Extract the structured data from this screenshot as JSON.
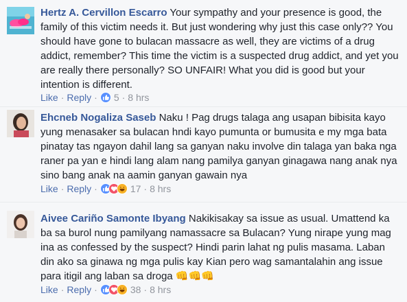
{
  "comments": [
    {
      "author": "Hertz A. Cervillon Escarro",
      "text": "Your sympathy and your presence is good, the family of this victim needs it. But just wondering why just this case only?? You should have gone to bulacan massacre as well, they are victims of a drug addict, remember? This time the victim is a suspected drug addict, and yet you are really there personally? SO UNFAIR! What you did is good but your intention is different.",
      "like": "Like",
      "reply": "Reply",
      "reaction_count": "5",
      "reaction_icons": [
        "like-icon"
      ],
      "time": "8 hrs"
    },
    {
      "author": "Ehcneb Nogaliza Saseb",
      "text": "Naku ! Pag drugs talaga ang usapan bibisita kayo yung menasaker sa bulacan hndi kayo pumunta or bumusita e my mga bata pinatay tas ngayon dahil lang sa ganyan naku involve din talaga yan baka nga raner pa yan e hindi lang alam nang pamilya ganyan ginagawa nang anak nya sino bang anak na aamin ganyan gawain nya",
      "like": "Like",
      "reply": "Reply",
      "reaction_count": "17",
      "reaction_icons": [
        "like-icon",
        "love-icon",
        "haha-icon"
      ],
      "time": "8 hrs"
    },
    {
      "author": "Aivee Cariño Samonte Ibyang",
      "text": "Nakikisakay sa issue as usual. Umattend ka ba sa burol nung pamilyang namassacre sa Bulacan? Yung nirape yung mag ina as confessed by the suspect? Hindi parin lahat ng pulis masama. Laban din ako sa ginawa ng mga pulis kay Kian pero wag samantalahin ang issue para itigil ang laban sa droga",
      "emoji": "👊👊👊",
      "like": "Like",
      "reply": "Reply",
      "reaction_count": "38",
      "reaction_icons": [
        "like-icon",
        "love-icon",
        "haha-icon"
      ],
      "time": "8 hrs"
    }
  ],
  "colors": {
    "author": "#365899",
    "link": "#4b6cad",
    "meta": "#90949c",
    "like": "#5890ff",
    "love": "#f25268",
    "haha": "#f7b125"
  }
}
